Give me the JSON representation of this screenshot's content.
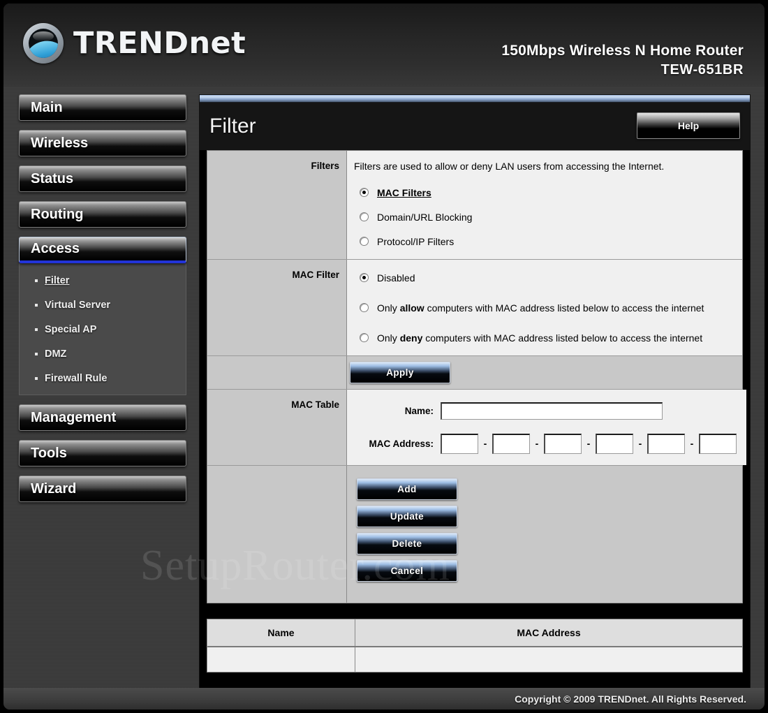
{
  "brand": {
    "logo_text_upper": "TREND",
    "logo_text_lower": "net",
    "logo_icon": "trendnet-globe-wave-icon"
  },
  "header": {
    "product_title": "150Mbps Wireless N Home Router",
    "model_number": "TEW-651BR"
  },
  "sidebar": {
    "items": [
      {
        "label": "Main",
        "active": false
      },
      {
        "label": "Wireless",
        "active": false
      },
      {
        "label": "Status",
        "active": false
      },
      {
        "label": "Routing",
        "active": false
      },
      {
        "label": "Access",
        "active": true
      },
      {
        "label": "Management",
        "active": false
      },
      {
        "label": "Tools",
        "active": false
      },
      {
        "label": "Wizard",
        "active": false
      }
    ],
    "submenu": [
      {
        "label": "Filter",
        "current": true
      },
      {
        "label": "Virtual Server",
        "current": false
      },
      {
        "label": "Special AP",
        "current": false
      },
      {
        "label": "DMZ",
        "current": false
      },
      {
        "label": "Firewall Rule",
        "current": false
      }
    ]
  },
  "content": {
    "page_title": "Filter",
    "help_label": "Help"
  },
  "filters_section": {
    "label": "Filters",
    "description": "Filters are used to allow or deny LAN users from accessing the Internet.",
    "options": [
      {
        "label": "MAC Filters",
        "selected": true
      },
      {
        "label": "Domain/URL Blocking",
        "selected": false
      },
      {
        "label": "Protocol/IP Filters",
        "selected": false
      }
    ]
  },
  "mac_filter_section": {
    "label": "MAC Filter",
    "options": [
      {
        "text_before": "",
        "emphasis": "",
        "text_after": "Disabled",
        "selected": true
      },
      {
        "text_before": "Only ",
        "emphasis": "allow",
        "text_after": " computers with MAC address listed below to access the internet",
        "selected": false
      },
      {
        "text_before": "Only ",
        "emphasis": "deny",
        "text_after": " computers with MAC address listed below to access the internet",
        "selected": false
      }
    ]
  },
  "apply_section": {
    "label": "",
    "apply_label": "Apply"
  },
  "mac_table_section": {
    "label": "MAC Table",
    "name_label": "Name:",
    "name_value": "",
    "mac_label": "MAC Address:",
    "mac_separator": "-",
    "mac_octets": [
      "",
      "",
      "",
      "",
      "",
      ""
    ]
  },
  "crud_buttons": {
    "add_label": "Add",
    "update_label": "Update",
    "delete_label": "Delete",
    "cancel_label": "Cancel"
  },
  "results_table": {
    "columns": [
      "Name",
      "MAC Address"
    ],
    "rows": [
      {
        "name": "",
        "mac_address": ""
      }
    ]
  },
  "footer": {
    "copyright": "Copyright © 2009 TRENDnet. All Rights Reserved."
  },
  "watermark": {
    "text": "SetupRouter.com"
  },
  "colors": {
    "page_background": "#3a3a3a",
    "accent_blue": "#2233d8",
    "panel_light": "#f0f0f0",
    "panel_gray": "#c8c8c8"
  }
}
